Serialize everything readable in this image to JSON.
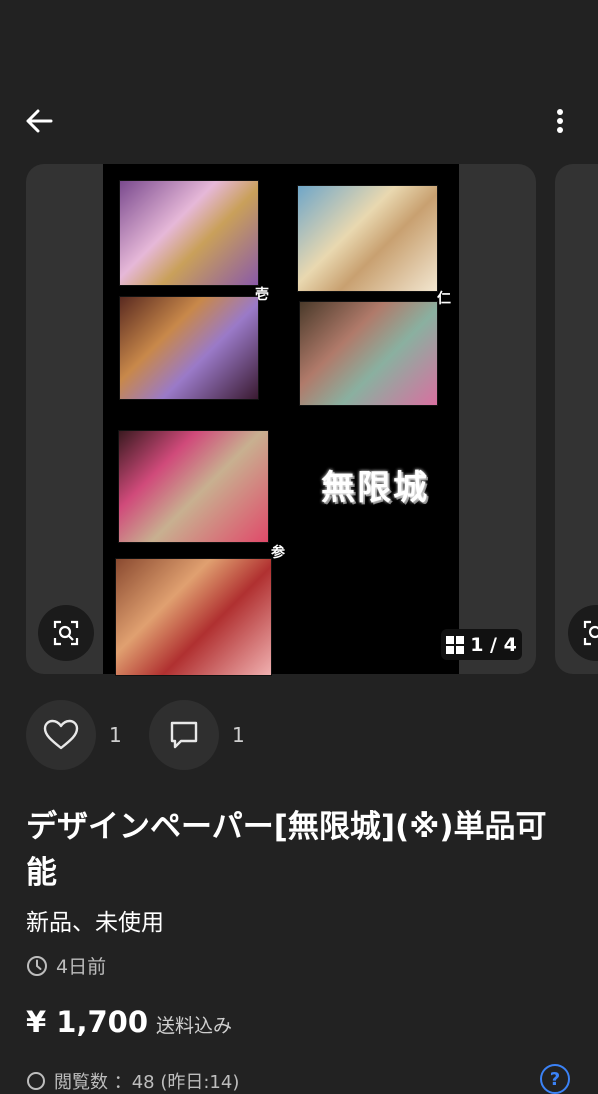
{
  "header": {
    "back_icon": "arrow-left-icon",
    "menu_icon": "more-vertical-icon"
  },
  "gallery": {
    "poster_title": "無限城",
    "thumb_labels": [
      "壱",
      "仁",
      "参"
    ],
    "pager": "1 / 4",
    "zoom_icon": "image-search-icon"
  },
  "actions": {
    "likes": "1",
    "comments": "1"
  },
  "product": {
    "title": "デザインペーパー[無限城](※)単品可能",
    "condition": "新品、未使用",
    "posted": "4日前",
    "price": "¥ 1,700",
    "shipping": "送料込み",
    "views": "閲覧数 ：48 (昨日:14)"
  },
  "colors": {
    "background": "#222222",
    "card": "#333333",
    "help": "#3b82f6"
  }
}
